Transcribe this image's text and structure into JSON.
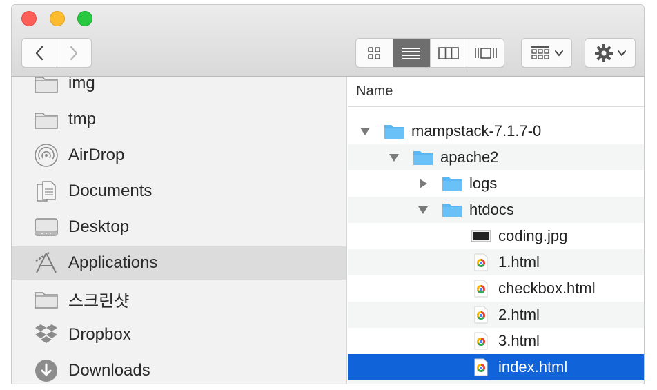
{
  "window": {
    "sidebar": {
      "items": [
        {
          "label": "img",
          "icon": "folder-icon"
        },
        {
          "label": "tmp",
          "icon": "folder-icon"
        },
        {
          "label": "AirDrop",
          "icon": "airdrop-icon"
        },
        {
          "label": "Documents",
          "icon": "documents-icon"
        },
        {
          "label": "Desktop",
          "icon": "desktop-icon"
        },
        {
          "label": "Applications",
          "icon": "applications-icon",
          "selected": true
        },
        {
          "label": "스크린샷",
          "icon": "folder-icon"
        },
        {
          "label": "Dropbox",
          "icon": "dropbox-icon"
        },
        {
          "label": "Downloads",
          "icon": "downloads-icon"
        }
      ]
    },
    "content": {
      "column_header": "Name",
      "rows": [
        {
          "label": "mampstack-7.1.7-0",
          "type": "folder",
          "expanded": true
        },
        {
          "label": "apache2",
          "type": "folder",
          "expanded": true
        },
        {
          "label": "logs",
          "type": "folder",
          "expanded": false
        },
        {
          "label": "htdocs",
          "type": "folder",
          "expanded": true
        },
        {
          "label": "coding.jpg",
          "type": "image"
        },
        {
          "label": "1.html",
          "type": "html"
        },
        {
          "label": "checkbox.html",
          "type": "html"
        },
        {
          "label": "2.html",
          "type": "html"
        },
        {
          "label": "3.html",
          "type": "html"
        },
        {
          "label": "index.html",
          "type": "html",
          "selected": true
        }
      ]
    },
    "colors": {
      "selection_blue": "#1063d8",
      "folder_blue": "#5ab7f2",
      "sidebar_bg": "#f2f2f2"
    }
  }
}
